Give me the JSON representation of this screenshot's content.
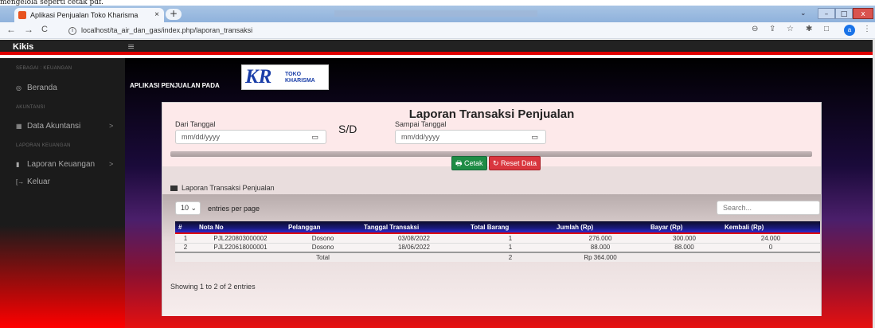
{
  "caption": "mengelola seperti cetak pdf.",
  "browser": {
    "tab_title": "Aplikasi Penjualan Toko Kharisma",
    "tab_close": "×",
    "new_tab": "+",
    "url": "localhost/ta_air_dan_gas/index.php/laporan_transaksi",
    "back": "←",
    "forward": "→",
    "reload": "C",
    "profile_initial": "a",
    "window_min": "–",
    "window_max": "□",
    "window_close": "x"
  },
  "app": {
    "brand": "Kikis",
    "hamburger": "≡",
    "header_label": "APLIKASI PENJUALAN PADA",
    "logo_kr": "KR",
    "logo_line1": "TOKO",
    "logo_line2": "KHARISMA"
  },
  "sidebar": {
    "sections": [
      {
        "heading": "SEBAGAI : KEUANGAN",
        "item": "Beranda",
        "icon": "gauge-icon",
        "glyph": "◎"
      },
      {
        "heading": "AKUNTANSI",
        "item": "Data Akuntansi",
        "icon": "table-icon",
        "glyph": "▦",
        "arrow": ">"
      },
      {
        "heading": "LAPORAN KEUANGAN",
        "item": "Laporan Keuangan",
        "icon": "book-icon",
        "glyph": "▮",
        "arrow": ">"
      },
      {
        "heading": "",
        "item": "Keluar",
        "icon": "logout-icon",
        "glyph": "[→"
      }
    ]
  },
  "report": {
    "title": "Laporan Transaksi Penjualan",
    "from_label": "Dari Tanggal",
    "from_placeholder": "mm/dd/yyyy",
    "separator": "S/D",
    "to_label": "Sampai Tanggal",
    "to_placeholder": "mm/dd/yyyy",
    "print_button": "🖶 Cetak",
    "reset_button": "↻ Reset Data",
    "section_title": "Laporan Transaksi Penjualan"
  },
  "table": {
    "page_length": "10 ⌄",
    "entries_label": "entries per page",
    "search_placeholder": "Search...",
    "columns": [
      "#",
      "Nota No",
      "Pelanggan",
      "Tanggal Transaksi",
      "Total Barang",
      "Jumlah (Rp)",
      "Bayar (Rp)",
      "Kembali (Rp)"
    ],
    "rows": [
      [
        "1",
        "PJL220803000002",
        "Dosono",
        "03/08/2022",
        "1",
        "276.000",
        "300.000",
        "24.000"
      ],
      [
        "2",
        "PJL220618000001",
        "Dosono",
        "18/06/2022",
        "1",
        "88.000",
        "88.000",
        "0"
      ]
    ],
    "total_row": [
      "",
      "",
      "Total",
      "",
      "2",
      "Rp 364.000",
      "",
      ""
    ],
    "info": "Showing 1 to 2 of 2 entries"
  }
}
